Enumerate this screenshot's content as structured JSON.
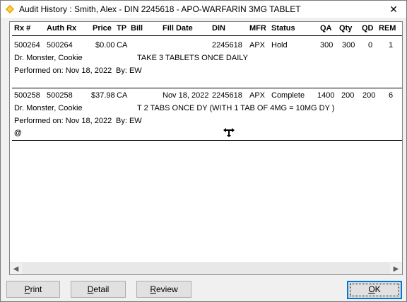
{
  "window": {
    "title": "Audit History : Smith, Alex - DIN 2245618 - APO-WARFARIN 3MG TABLET",
    "close_glyph": "✕"
  },
  "columns": [
    "Rx #",
    "Auth Rx",
    "Price",
    "TP",
    "Bill",
    "Fill Date",
    "DIN",
    "MFR",
    "Status",
    "QA",
    "Qty",
    "QD",
    "REM"
  ],
  "records": [
    {
      "rx": "500264",
      "auth_rx": "500264",
      "price": "$0.00",
      "tp": "CA",
      "bill": "",
      "fill_date": "",
      "din": "2245618",
      "mfr": "APX",
      "status": "Hold",
      "qa": "300",
      "qty": "300",
      "qd": "0",
      "rem": "1",
      "doctor": "Dr. Monster, Cookie",
      "directions": "TAKE 3 TABLETS ONCE DAILY",
      "performed": "Performed on: Nov 18, 2022",
      "by": "By: EW"
    },
    {
      "rx": "500258",
      "auth_rx": "500258",
      "price": "$37.98",
      "tp": "CA",
      "bill": "",
      "fill_date": "Nov 18, 2022",
      "din": "2245618",
      "mfr": "APX",
      "status": "Complete",
      "qa": "1400",
      "qty": "200",
      "qd": "200",
      "rem": "6",
      "doctor": "Dr. Monster, Cookie",
      "directions": "T 2 TABS ONCE DY (WITH 1 TAB OF 4MG = 10MG DY )",
      "performed": "Performed on: Nov 18, 2022",
      "by": "By: EW"
    }
  ],
  "marker": "@",
  "scrollbar": {
    "left_arrow": "◀",
    "right_arrow": "▶"
  },
  "buttons": {
    "print": {
      "mnemonic": "P",
      "rest": "rint"
    },
    "detail": {
      "mnemonic": "D",
      "rest": "etail"
    },
    "review": {
      "mnemonic": "R",
      "rest": "eview"
    },
    "ok": {
      "mnemonic": "O",
      "rest": "K"
    }
  }
}
